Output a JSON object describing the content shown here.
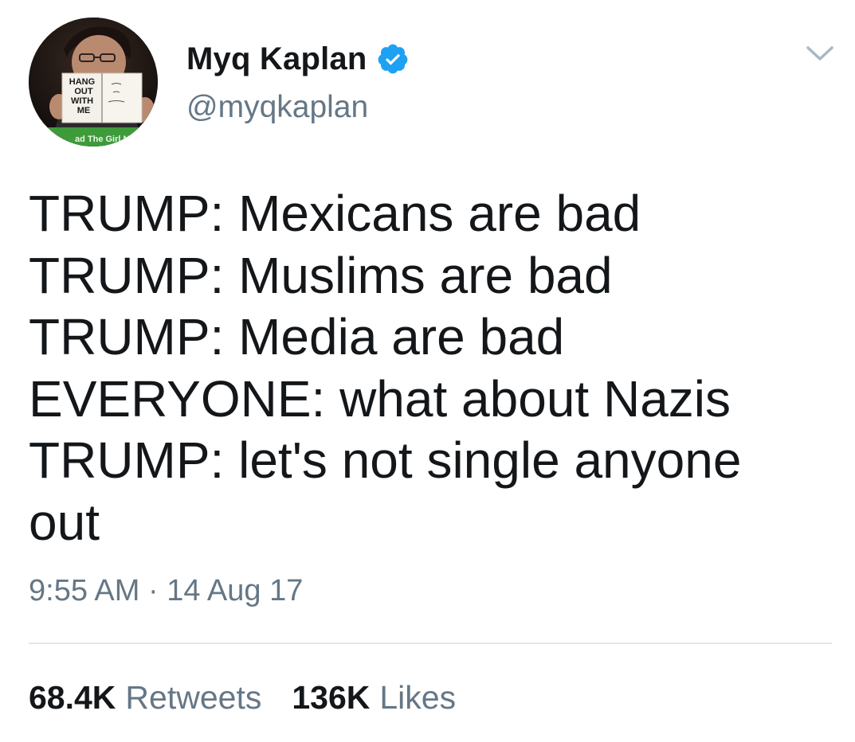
{
  "author": {
    "display_name": "Myq Kaplan",
    "handle": "@myqkaplan",
    "verified": true,
    "verified_color": "#1da1f2",
    "avatar": {
      "sign_text": [
        "HANG",
        "OUT",
        "WITH",
        "ME"
      ],
      "banner_text": "ad The Girl N",
      "icon": "avatar-photo"
    }
  },
  "menu": {
    "icon": "chevron-down-icon"
  },
  "tweet": {
    "lines": [
      "TRUMP: Mexicans are bad",
      "TRUMP: Muslims are bad",
      "TRUMP: Media are bad",
      "EVERYONE: what about Nazis",
      "TRUMP: let's not single anyone",
      "out"
    ],
    "timestamp": "9:55 AM · 14 Aug 17"
  },
  "stats": {
    "retweets_count": "68.4K",
    "retweets_label": "Retweets",
    "likes_count": "136K",
    "likes_label": "Likes"
  },
  "colors": {
    "text_primary": "#14171a",
    "text_secondary": "#657786",
    "divider": "#e1e8ed",
    "verified_badge": "#1da1f2"
  }
}
